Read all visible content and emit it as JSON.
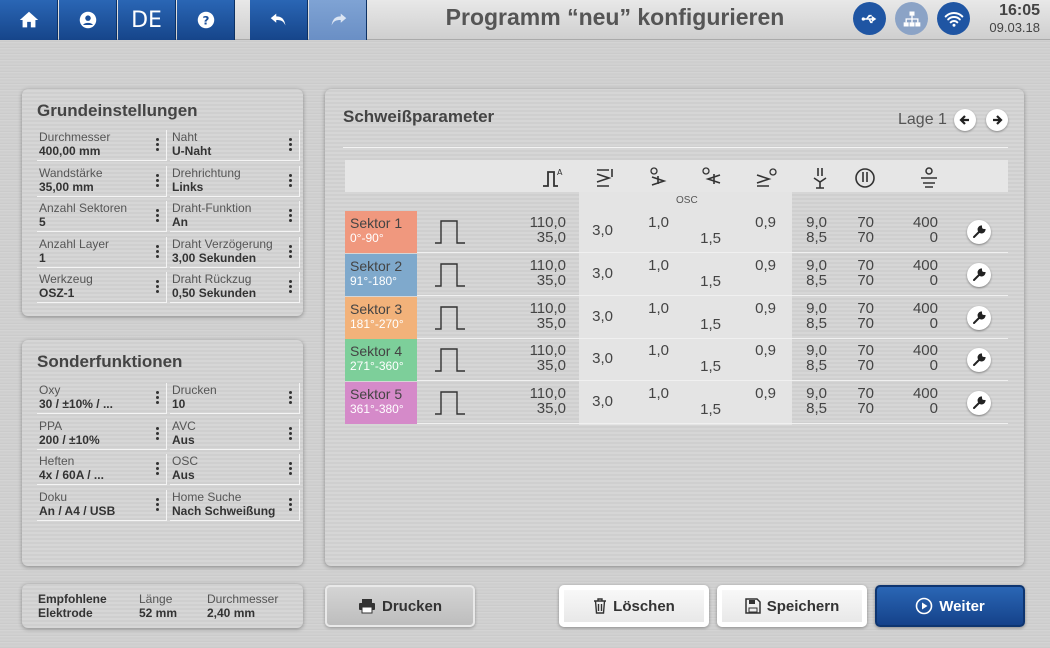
{
  "header": {
    "title": "Programm “neu” konfigurieren",
    "language": "DE",
    "time": "16:05",
    "date": "09.03.18"
  },
  "grund": {
    "title": "Grundeinstellungen",
    "fields": [
      {
        "label": "Durchmesser",
        "value": "400,00 mm"
      },
      {
        "label": "Naht",
        "value": "U-Naht"
      },
      {
        "label": "Wandstärke",
        "value": "35,00 mm"
      },
      {
        "label": "Drehrichtung",
        "value": "Links"
      },
      {
        "label": "Anzahl Sektoren",
        "value": "5"
      },
      {
        "label": "Draht-Funktion",
        "value": "An"
      },
      {
        "label": "Anzahl Layer",
        "value": "1"
      },
      {
        "label": "Draht Verzögerung",
        "value": "3,00 Sekunden"
      },
      {
        "label": "Werkzeug",
        "value": "OSZ-1"
      },
      {
        "label": "Draht Rückzug",
        "value": "0,50 Sekunden"
      }
    ]
  },
  "sonder": {
    "title": "Sonderfunktionen",
    "fields": [
      {
        "label": "Oxy",
        "value": "30 / ±10% / ..."
      },
      {
        "label": "Drucken",
        "value": "10"
      },
      {
        "label": "PPA",
        "value": "200 / ±10%"
      },
      {
        "label": "AVC",
        "value": "Aus"
      },
      {
        "label": "Heften",
        "value": "4x / 60A / ..."
      },
      {
        "label": "OSC",
        "value": "Aus"
      },
      {
        "label": "Doku",
        "value": "An / A4 / USB"
      },
      {
        "label": "Home Suche",
        "value": "Nach Schweißung"
      }
    ]
  },
  "elektrode": {
    "title_line1": "Empfohlene",
    "title_line2": "Elektrode",
    "length_label": "Länge",
    "length_value": "52 mm",
    "diameter_label": "Durchmesser",
    "diameter_value": "2,40 mm"
  },
  "params": {
    "title": "Schweißparameter",
    "lage": "Lage 1",
    "osc_label": "OSC",
    "rows": [
      {
        "name": "Sektor 1",
        "range": "0°-90°",
        "color": "#f0987e",
        "current_hi": "110,0",
        "current_lo": "35,0",
        "c1": "3,0",
        "c2": "1,0",
        "c3": "1,5",
        "c4": "0,9",
        "c5_hi": "9,0",
        "c5_lo": "8,5",
        "c6_hi": "70",
        "c6_lo": "70",
        "c7_hi": "400",
        "c7_lo": "0"
      },
      {
        "name": "Sektor 2",
        "range": "91°-180°",
        "color": "#7fa9cc",
        "current_hi": "110,0",
        "current_lo": "35,0",
        "c1": "3,0",
        "c2": "1,0",
        "c3": "1,5",
        "c4": "0,9",
        "c5_hi": "9,0",
        "c5_lo": "8,5",
        "c6_hi": "70",
        "c6_lo": "70",
        "c7_hi": "400",
        "c7_lo": "0"
      },
      {
        "name": "Sektor 3",
        "range": "181°-270°",
        "color": "#f2b27a",
        "current_hi": "110,0",
        "current_lo": "35,0",
        "c1": "3,0",
        "c2": "1,0",
        "c3": "1,5",
        "c4": "0,9",
        "c5_hi": "9,0",
        "c5_lo": "8,5",
        "c6_hi": "70",
        "c6_lo": "70",
        "c7_hi": "400",
        "c7_lo": "0"
      },
      {
        "name": "Sektor 4",
        "range": "271°-360°",
        "color": "#7dcf9a",
        "current_hi": "110,0",
        "current_lo": "35,0",
        "c1": "3,0",
        "c2": "1,0",
        "c3": "1,5",
        "c4": "0,9",
        "c5_hi": "9,0",
        "c5_lo": "8,5",
        "c6_hi": "70",
        "c6_lo": "70",
        "c7_hi": "400",
        "c7_lo": "0"
      },
      {
        "name": "Sektor 5",
        "range": "361°-380°",
        "color": "#d58ac9",
        "current_hi": "110,0",
        "current_lo": "35,0",
        "c1": "3,0",
        "c2": "1,0",
        "c3": "1,5",
        "c4": "0,9",
        "c5_hi": "9,0",
        "c5_lo": "8,5",
        "c6_hi": "70",
        "c6_lo": "70",
        "c7_hi": "400",
        "c7_lo": "0"
      }
    ]
  },
  "buttons": {
    "print": "Drucken",
    "delete": "Löschen",
    "save": "Speichern",
    "next": "Weiter"
  }
}
